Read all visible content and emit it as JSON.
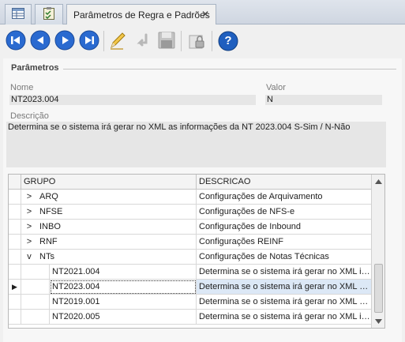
{
  "tab": {
    "title": "Parâmetros de Regra e Padrões",
    "close": "✕"
  },
  "toolbar": {
    "icons": [
      "first-record-icon",
      "previous-record-icon",
      "next-record-icon",
      "last-record-icon",
      "edit-icon",
      "undo-icon",
      "save-icon",
      "lock-icon",
      "help-icon"
    ],
    "help_glyph": "?"
  },
  "params": {
    "section_title": "Parâmetros",
    "name_label": "Nome",
    "name_value": "NT2023.004",
    "value_label": "Valor",
    "value_value": "N",
    "desc_label": "Descrição",
    "desc_value": "Determina se o sistema irá gerar no XML as informações da NT 2023.004 S-Sim / N-Não"
  },
  "grid": {
    "columns": {
      "group": "GRUPO",
      "description": "DESCRICAO"
    },
    "groups": [
      {
        "expander": ">",
        "group": "ARQ",
        "description": "Configurações de Arquivamento"
      },
      {
        "expander": ">",
        "group": "NFSE",
        "description": "Configurações de NFS-e"
      },
      {
        "expander": ">",
        "group": "INBO",
        "description": "Configurações de Inbound"
      },
      {
        "expander": ">",
        "group": "RNF",
        "description": "Configurações REINF"
      },
      {
        "expander": "v",
        "group": "NTs",
        "description": "Configurações de Notas Técnicas"
      }
    ],
    "children": [
      {
        "name": "NT2021.004",
        "description": "Determina se o sistema irá gerar no XML in..."
      },
      {
        "name": "NT2023.004",
        "description": "Determina se o sistema irá gerar no XML a..."
      },
      {
        "name": "NT2019.001",
        "description": "Determina se o sistema irá gerar no XML a..."
      },
      {
        "name": "NT2020.005",
        "description": "Determina se o sistema irá gerar no XML in..."
      }
    ],
    "selected_indicator": "▶"
  },
  "colors": {
    "accent": "#1f5fbf",
    "selection": "#dce8f6"
  }
}
